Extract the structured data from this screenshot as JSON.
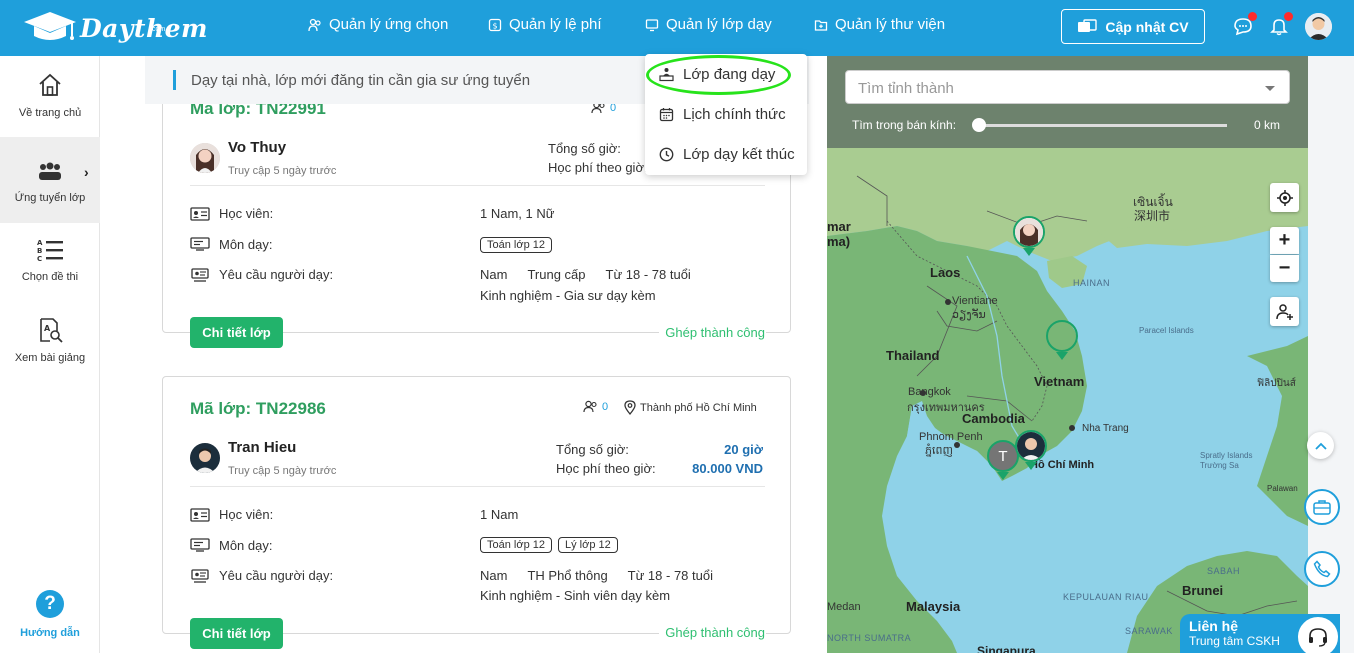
{
  "header": {
    "logo_text": "Daythem",
    "logo_sub": ".com",
    "nav": [
      {
        "label": "Quản lý ứng chọn",
        "icon": "users-icon"
      },
      {
        "label": "Quản lý lệ phí",
        "icon": "fee-icon"
      },
      {
        "label": "Quản lý lớp dạy",
        "icon": "monitor-icon"
      },
      {
        "label": "Quản lý thư viện",
        "icon": "folder-icon"
      }
    ],
    "update_cv_label": "Cập nhật CV"
  },
  "dropdown": {
    "items": [
      {
        "label": "Lớp đang dạy",
        "icon": "teacher-board-icon"
      },
      {
        "label": "Lịch chính thức",
        "icon": "calendar-icon"
      },
      {
        "label": "Lớp dạy kết thúc",
        "icon": "clock-icon"
      }
    ]
  },
  "sidebar": {
    "items": [
      {
        "label": "Về trang chủ",
        "icon": "home-icon"
      },
      {
        "label": "Ứng tuyển lớp",
        "icon": "group-icon"
      },
      {
        "label": "Chọn đề thi",
        "icon": "abc-list-icon"
      },
      {
        "label": "Xem bài giảng",
        "icon": "lesson-search-icon"
      }
    ],
    "help_label": "Hướng dẫn",
    "help_icon_text": "?",
    "active_arrow": "›"
  },
  "banner": {
    "text": "Dạy tại nhà, lớp mới đăng tin cần gia sư ứng tuyển"
  },
  "cards": [
    {
      "code": "Mã lớp: TN22991",
      "applicants": "0",
      "tutor_name": "Vo Thuy",
      "tutor_sub": "Truy cập 5 ngày trước",
      "hours_label": "Tổng số giờ:",
      "fee_label": "Học phí theo giờ:",
      "student_label": "Học viên:",
      "student_val": "1 Nam, 1 Nữ",
      "subject_label": "Môn dạy:",
      "subjects": [
        "Toán lớp 12"
      ],
      "req_label": "Yêu cầu người dạy:",
      "req_gender": "Nam",
      "req_level": "Trung cấp",
      "req_age": "Từ 18 - 78 tuổi",
      "req_exp": "Kinh nghiệm - Gia sư dạy kèm",
      "detail_btn": "Chi tiết lớp",
      "status": "Ghép thành công"
    },
    {
      "code": "Mã lớp: TN22986",
      "applicants": "0",
      "location": "Thành phố Hồ Chí Minh",
      "tutor_name": "Tran Hieu",
      "tutor_sub": "Truy cập 5 ngày trước",
      "hours_label": "Tổng số giờ:",
      "hours_val": "20 giờ",
      "fee_label": "Học phí theo giờ:",
      "fee_val": "80.000 VND",
      "student_label": "Học viên:",
      "student_val": "1 Nam",
      "subject_label": "Môn dạy:",
      "subjects": [
        "Toán lớp 12",
        "Lý lớp 12"
      ],
      "req_label": "Yêu cầu người dạy:",
      "req_gender": "Nam",
      "req_level": "TH Phổ thông",
      "req_age": "Từ 18 - 78 tuổi",
      "req_exp": "Kinh nghiệm - Sinh viên dạy kèm",
      "detail_btn": "Chi tiết lớp",
      "status": "Ghép thành công"
    }
  ],
  "map": {
    "search_placeholder": "Tìm tỉnh thành",
    "radius_label": "Tìm trong bán kính:",
    "radius_value": "0 km",
    "radius_fraction": 0,
    "zoom_in": "+",
    "zoom_out": "−",
    "labels": {
      "laos": "Laos",
      "thailand": "Thailand",
      "vietnam": "Vietnam",
      "cambodia": "Cambodia",
      "malaysia": "Malaysia",
      "brunei": "Brunei",
      "hainan": "HAINAN",
      "vientiane": "Vientiane",
      "vientiane_local": "ວຽງຈັນ",
      "bangkok": "Bangkok",
      "bangkok_local": "กรุงเทพมหานคร",
      "phnom_penh": "Phnom Penh",
      "phnom_penh_local": "ភ្នំពេញ",
      "hcm": "Hồ Chí Minh",
      "nha_trang": "Nha Trang",
      "shenzhen": "深圳市",
      "shenzhen_latin": "เซินเจิ้น",
      "medan": "Medan",
      "paracel": "Paracel Islands",
      "spratly": "Trường Sa",
      "spratly_en": "Spratly Islands",
      "palawan": "Palawan",
      "sabah": "SABAH",
      "sarawak": "SARAWAK",
      "kepulauan_riau": "KEPULAUAN RIAU",
      "north_sumatra": "NORTH SUMATRA",
      "myanmar": "mar",
      "myanmar2": "ma)",
      "philippines": "ฟิลิปปินส์",
      "sunda": "Singapura"
    },
    "marker_letter": "T"
  },
  "contact": {
    "title": "Liên hệ",
    "sub": "Trung tâm CSKH"
  },
  "colors": {
    "primary": "#1f9fdb",
    "green": "#22b36b",
    "highlight": "#27e31b"
  }
}
